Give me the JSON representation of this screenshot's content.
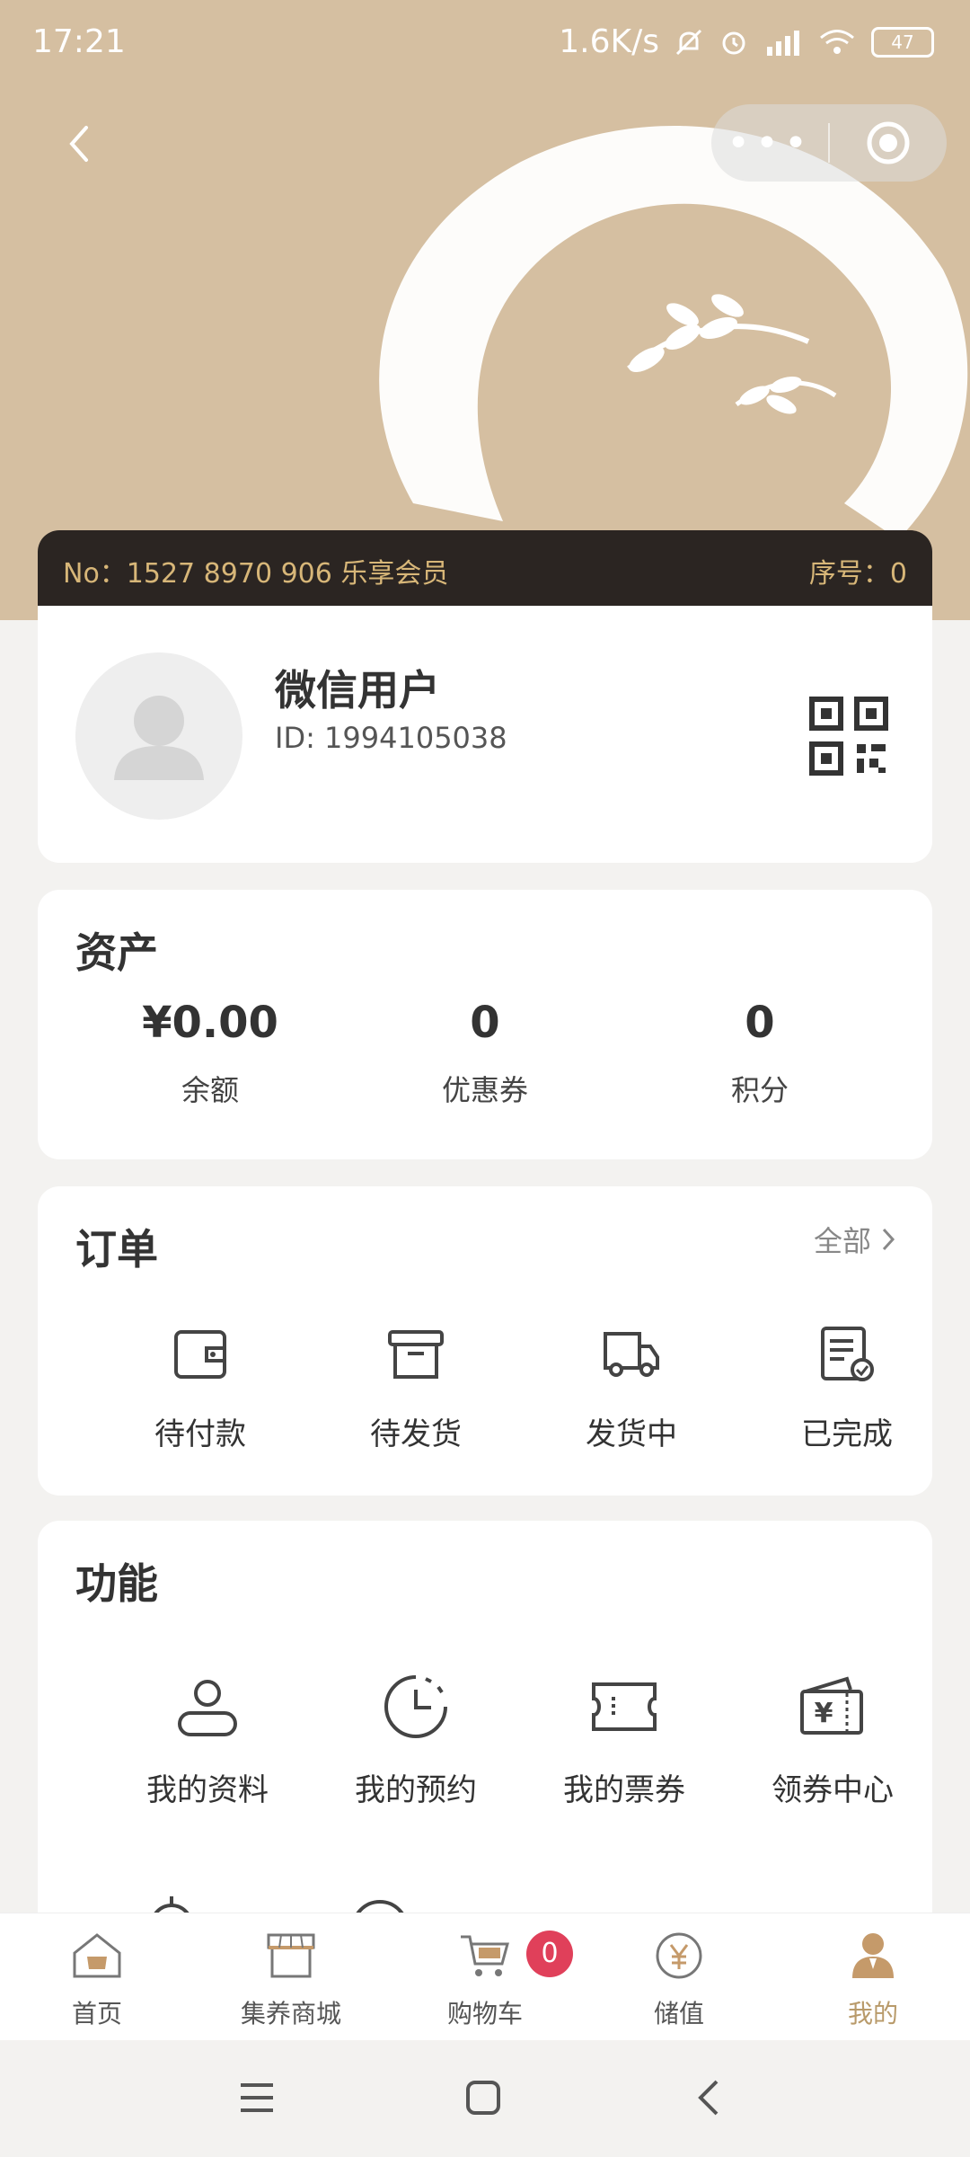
{
  "status_bar": {
    "time": "17:21",
    "net_speed": "1.6K/s",
    "battery": "47"
  },
  "member_bar": {
    "no_text": "No：1527 8970 906 乐享会员",
    "seq_text": "序号：0"
  },
  "profile": {
    "name": "微信用户",
    "id_text": "ID: 1994105038"
  },
  "assets": {
    "title": "资产",
    "items": [
      {
        "value": "¥0.00",
        "label": "余额"
      },
      {
        "value": "0",
        "label": "优惠券"
      },
      {
        "value": "0",
        "label": "积分"
      }
    ]
  },
  "orders": {
    "title": "订单",
    "all_label": "全部",
    "items": [
      {
        "label": "待付款",
        "icon": "wallet-icon"
      },
      {
        "label": "待发货",
        "icon": "box-icon"
      },
      {
        "label": "发货中",
        "icon": "truck-icon"
      },
      {
        "label": "已完成",
        "icon": "checklist-icon"
      }
    ]
  },
  "functions": {
    "title": "功能",
    "items": [
      {
        "label": "我的资料",
        "icon": "user-profile-icon"
      },
      {
        "label": "我的预约",
        "icon": "clock-icon"
      },
      {
        "label": "我的票券",
        "icon": "ticket-icon"
      },
      {
        "label": "领券中心",
        "icon": "coupon-wallet-icon"
      }
    ]
  },
  "tabbar": {
    "items": [
      {
        "label": "首页",
        "icon": "home-icon"
      },
      {
        "label": "集养商城",
        "icon": "store-icon"
      },
      {
        "label": "购物车",
        "icon": "cart-icon"
      },
      {
        "label": "储值",
        "icon": "yuan-coin-icon"
      },
      {
        "label": "我的",
        "icon": "person-icon",
        "active": true
      }
    ],
    "cart_count": "0"
  },
  "colors": {
    "header_bg": "#d5bfa1",
    "gold": "#d7b678",
    "accent": "#b89a6a",
    "badge": "#e0405a"
  }
}
